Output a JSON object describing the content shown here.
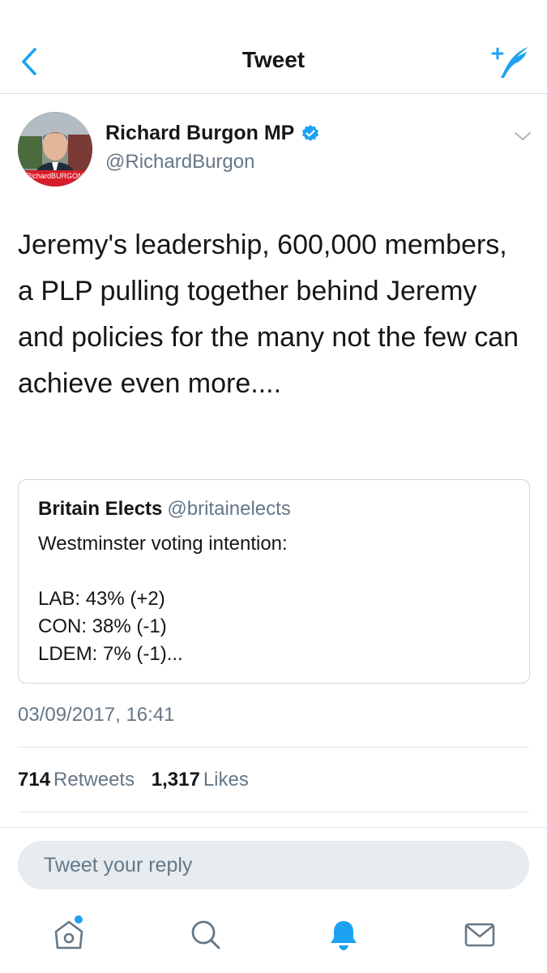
{
  "header": {
    "title": "Tweet",
    "back_icon": "chevron-left-icon",
    "compose_icon": "compose-tweet-icon"
  },
  "tweet": {
    "author_name": "Richard Burgon MP",
    "author_handle": "@RichardBurgon",
    "verified": true,
    "avatar_caption": "RichardBURGON",
    "text": "Jeremy's leadership, 600,000 members, a PLP pulling together behind Jeremy and policies for the many not the few can achieve even more....",
    "timestamp": "03/09/2017, 16:41",
    "retweets_count": "714",
    "retweets_label": "Retweets",
    "likes_count": "1,317",
    "likes_label": "Likes"
  },
  "quote": {
    "name": "Britain Elects",
    "handle": "@britainelects",
    "lines": [
      "Westminster voting intention:",
      "",
      "LAB: 43% (+2)",
      "CON: 38% (-1)",
      "LDEM: 7% (-1)..."
    ]
  },
  "reply": {
    "placeholder": "Tweet your reply"
  },
  "tabbar": {
    "items": [
      {
        "name": "home",
        "icon": "home-icon",
        "active": false,
        "has_dot": true
      },
      {
        "name": "search",
        "icon": "search-icon",
        "active": false
      },
      {
        "name": "notifications",
        "icon": "bell-icon",
        "active": true
      },
      {
        "name": "messages",
        "icon": "envelope-icon",
        "active": false
      }
    ]
  },
  "colors": {
    "accent": "#1da1f2",
    "text_primary": "#14171a",
    "text_secondary": "#657786",
    "input_bg": "#e6ecf0",
    "border": "#e1e8ed"
  }
}
